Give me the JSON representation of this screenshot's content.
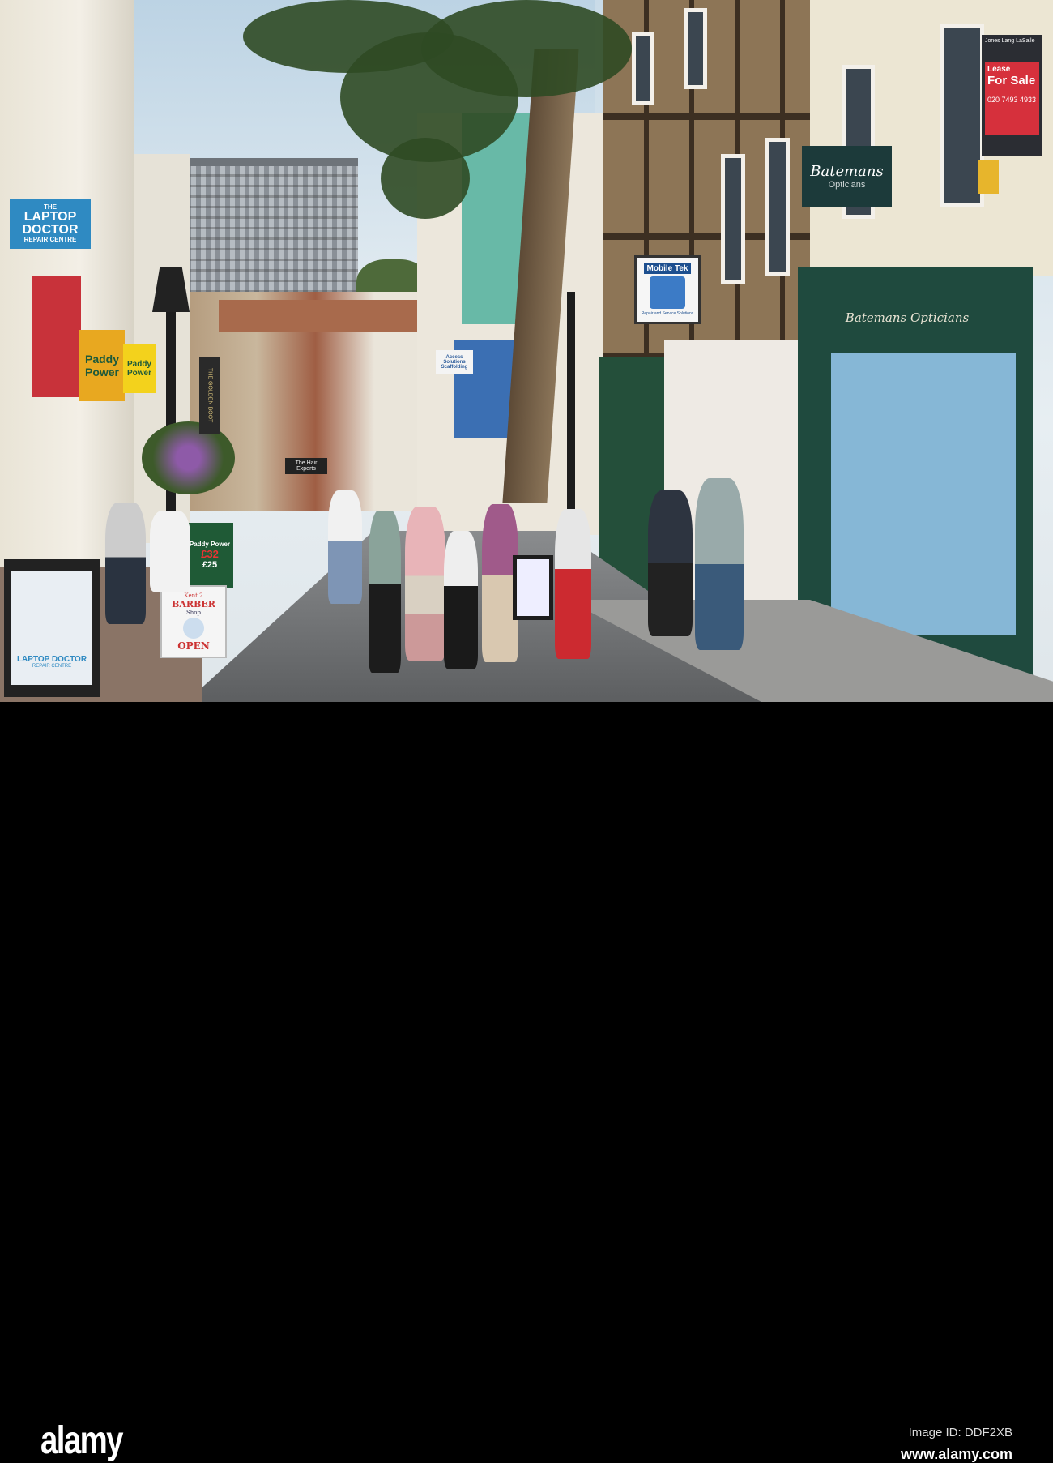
{
  "signs": {
    "laptop_doctor": {
      "line1": "THE",
      "line2": "LAPTOP",
      "line3": "DOCTOR",
      "line4": "REPAIR CENTRE"
    },
    "paddy_power": "Paddy Power",
    "paddy_power_board": {
      "title": "Paddy Power",
      "price1": "£32",
      "price2": "£25"
    },
    "mobile_tek": {
      "title": "Mobile Tek",
      "subtitle": "Repair and Service Solutions"
    },
    "batemans_hanging": {
      "script": "Batemans",
      "sub": "Opticians"
    },
    "batemans_fascia": "Batemans Opticians",
    "for_sale": {
      "agent": "Jones Lang LaSalle",
      "lease": "Lease",
      "for_sale": "For Sale",
      "phone": "020 7493 4933"
    },
    "barber": {
      "line1": "Kent 2",
      "line2": "BARBER",
      "line3": "Shop",
      "line4": "OPEN"
    },
    "laptop_doctor_board": {
      "line1": "LAPTOP DOCTOR",
      "line2": "REPAIR CENTRE"
    },
    "scaffolding": "Access Solutions Scaffolding",
    "golden_boot": "THE GOLDEN BOOT",
    "hair_experts": "The Hair Experts"
  },
  "footer": {
    "logo": "alamy",
    "image_id": "Image ID: DDF2XB",
    "url": "www.alamy.com"
  }
}
